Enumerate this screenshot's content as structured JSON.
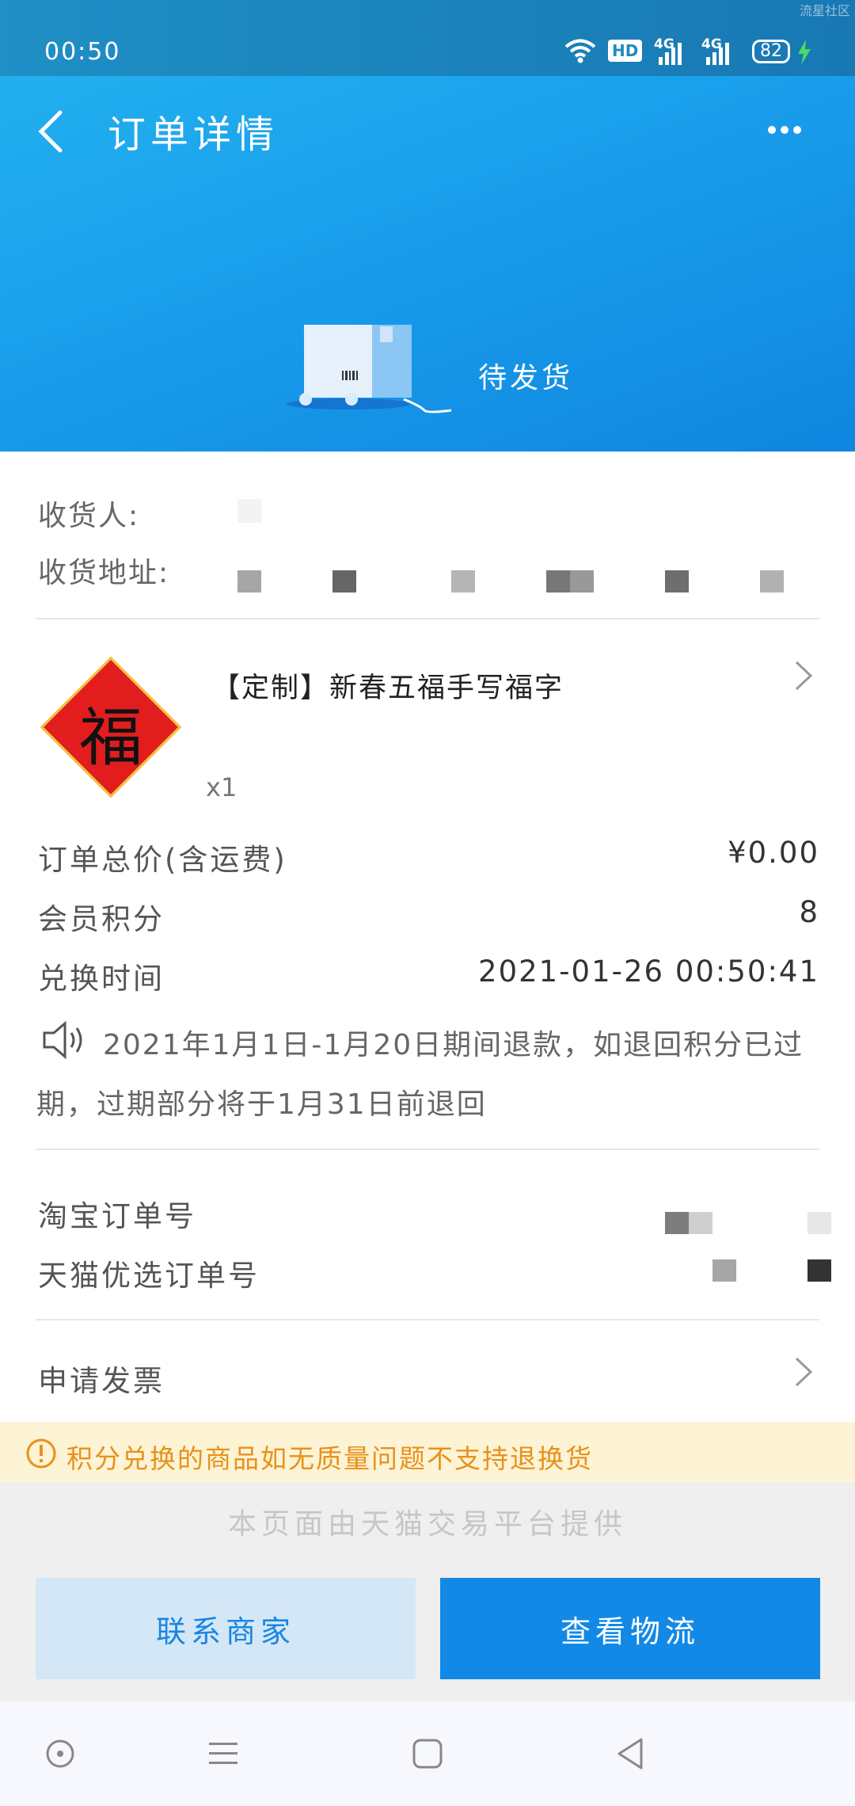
{
  "status_bar": {
    "time": "00:50",
    "watermark": "流星社区",
    "hd": "HD",
    "net1": "4G",
    "net2": "4G",
    "battery": "82"
  },
  "header": {
    "title": "订单详情",
    "order_status": "待发货"
  },
  "receiver": {
    "name_label": "收货人:",
    "address_label": "收货地址:"
  },
  "product": {
    "title": "【定制】新春五福手写福字",
    "quantity": "x1",
    "thumb_char": "福"
  },
  "summary": {
    "total_label": "订单总价(含运费)",
    "total_value": "¥0.00",
    "points_label": "会员积分",
    "points_value": "8",
    "time_label": "兑换时间",
    "time_value": "2021-01-26 00:50:41"
  },
  "notice": {
    "text": "2021年1月1日-1月20日期间退款，如退回积分已过期，过期部分将于1月31日前退回"
  },
  "orders": {
    "taobao_label": "淘宝订单号",
    "tmall_label": "天猫优选订单号"
  },
  "invoice": {
    "label": "申请发票"
  },
  "tip": {
    "text": "积分兑换的商品如无质量问题不支持退换货"
  },
  "footer": {
    "text": "本页面由天猫交易平台提供"
  },
  "actions": {
    "contact_label": "联系商家",
    "logistics_label": "查看物流"
  },
  "colors": {
    "header_blue": "#1aa0ec",
    "primary_button": "#1289e6",
    "secondary_button": "#d4e7f7",
    "tip_text": "#e8911a",
    "tip_bg": "#fdf3d5"
  }
}
